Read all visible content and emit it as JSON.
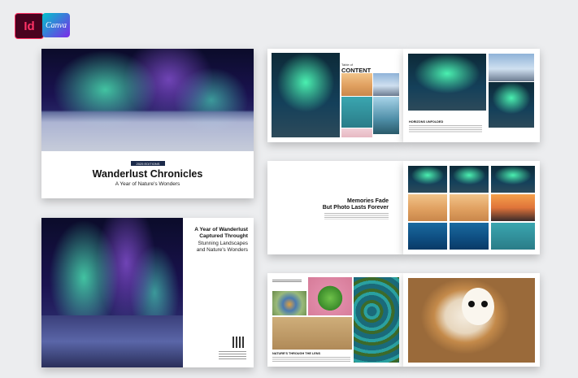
{
  "badges": {
    "indesign": "Id",
    "canva": "Canva"
  },
  "cover": {
    "tag": "2025 EDITIONS",
    "title": "Wanderlust Chronicles",
    "subtitle": "A Year of Nature's Wonders"
  },
  "back_cover": {
    "heading_line1": "A Year of Wanderlust",
    "heading_line2": "Captured Throught",
    "sub_line1": "Stunning Landscapes",
    "sub_line2": "and Nature's Wonders"
  },
  "spread1": {
    "toc_title_line1": "Table of",
    "toc_title_line2": "CONTENT",
    "right_caption": "HORIZONS UNFOLDED"
  },
  "spread2": {
    "quote_line1": "Memories Fade",
    "quote_line2": "But Photo Lasts Forever"
  },
  "spread3": {
    "left_caption": "NATURE'S THROUGH THE LENS"
  },
  "colors": {
    "tag_bg": "#1b2a4a",
    "indesign": "#ff3366"
  }
}
